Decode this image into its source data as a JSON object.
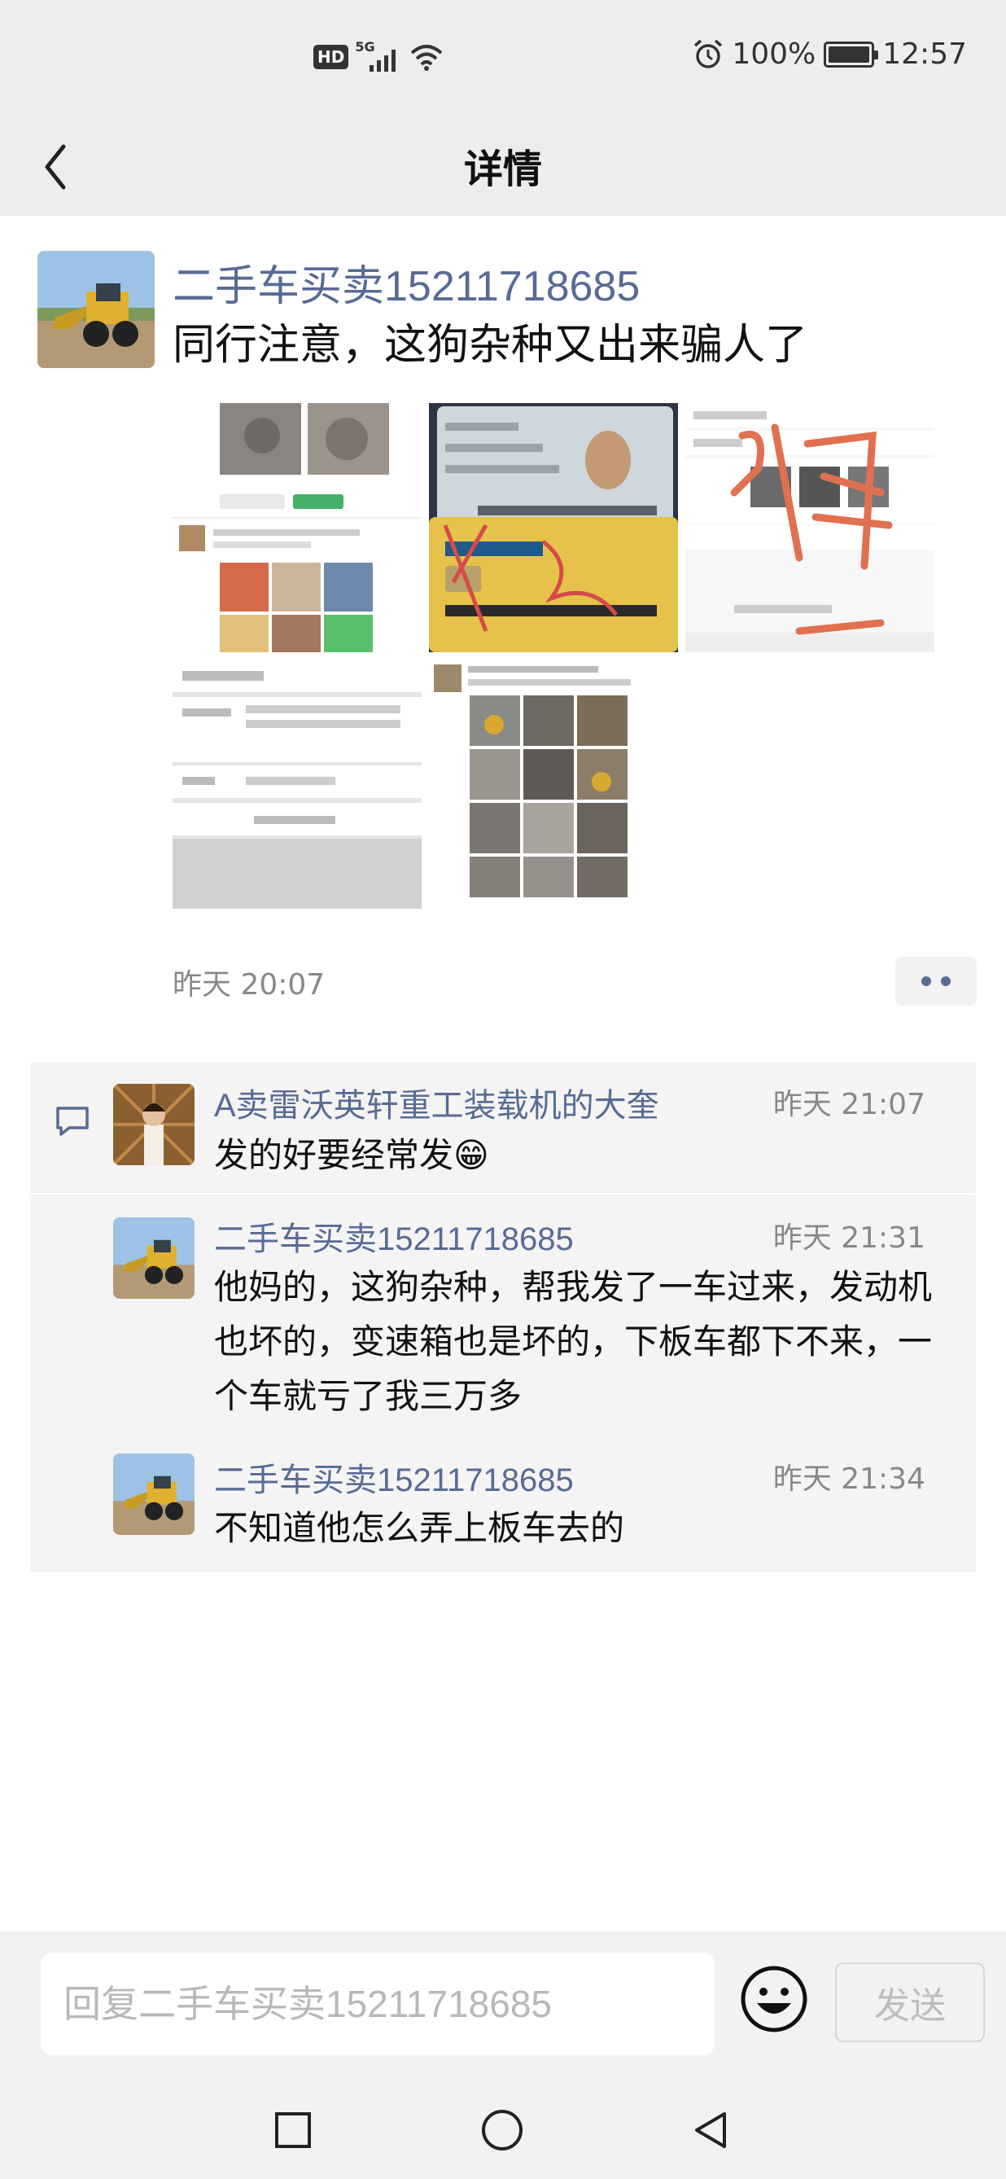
{
  "status_bar": {
    "hd": "HD",
    "network": "5G",
    "battery_percent": "100%",
    "time": "12:57"
  },
  "header": {
    "title": "详情"
  },
  "post": {
    "author": "二手车买卖15211718685",
    "text": "同行注意，这狗杂种又出来骗人了",
    "time": "昨天 20:07"
  },
  "comments": [
    {
      "author": "A卖雷沃英轩重工装载机的大奎",
      "time": "昨天 21:07",
      "text": "发的好要经常发😁"
    },
    {
      "author": "二手车买卖15211718685",
      "time": "昨天 21:31",
      "text": "他妈的，这狗杂种，帮我发了一车过来，发动机也坏的，变速箱也是坏的，下板车都下不来，一个车就亏了我三万多"
    },
    {
      "author": "二手车买卖15211718685",
      "time": "昨天 21:34",
      "text": "不知道他怎么弄上板车去的"
    }
  ],
  "reply_bar": {
    "placeholder": "回复二手车买卖15211718685",
    "send_label": "发送"
  }
}
